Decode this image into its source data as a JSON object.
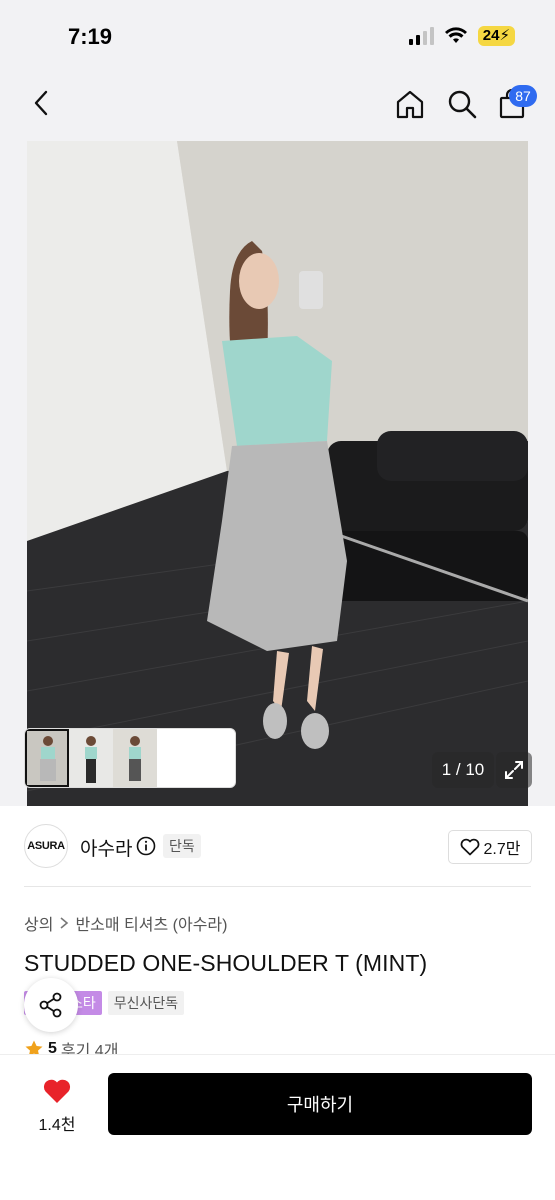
{
  "status_bar": {
    "time": "7:19",
    "battery": "24"
  },
  "header": {
    "cart_count": "87"
  },
  "gallery": {
    "counter": "1 / 10",
    "thumbnails": [
      "thumb-1",
      "thumb-2",
      "thumb-3"
    ]
  },
  "brand": {
    "logo_text": "ASURA",
    "name": "아수라",
    "tag": "단독",
    "like_count": "2.7만"
  },
  "product": {
    "breadcrumb": [
      "상의",
      "반소매 티셔츠 (아수라)"
    ],
    "title": "STUDDED ONE-SHOULDER T (MINT)",
    "tags": [
      {
        "label": "스타",
        "color": "#c48be6"
      },
      {
        "label": "무신사단독",
        "color": "#f1f1f1"
      }
    ],
    "rating": "5",
    "review_label": "후기 4개"
  },
  "bottom_bar": {
    "wish_count": "1.4천",
    "buy_label": "구매하기"
  },
  "colors": {
    "accent_blue": "#2f6bf0",
    "heart_red": "#e8232a",
    "buy_black": "#000000"
  }
}
